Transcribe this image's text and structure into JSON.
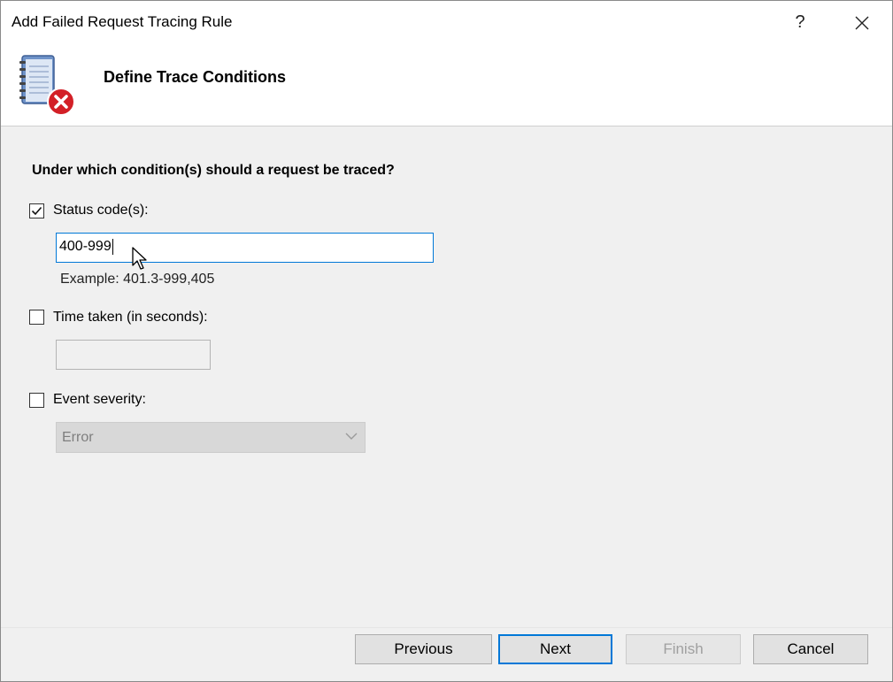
{
  "window": {
    "title": "Add Failed Request Tracing Rule",
    "help_glyph": "?",
    "close_glyph": "✕"
  },
  "header": {
    "title": "Define Trace Conditions",
    "icon": "trace-log-error-icon"
  },
  "form": {
    "question": "Under which condition(s) should a request be traced?",
    "status_code": {
      "label": "Status code(s):",
      "checked": true,
      "value": "400-999",
      "example": "Example: 401.3-999,405"
    },
    "time_taken": {
      "label": "Time taken (in seconds):",
      "checked": false,
      "value": ""
    },
    "event_severity": {
      "label": "Event severity:",
      "checked": false,
      "selected": "Error"
    }
  },
  "buttons": {
    "previous": "Previous",
    "next": "Next",
    "finish": "Finish",
    "cancel": "Cancel"
  },
  "colors": {
    "accent": "#0078d7",
    "dialog_bg": "#f0f0f0"
  }
}
